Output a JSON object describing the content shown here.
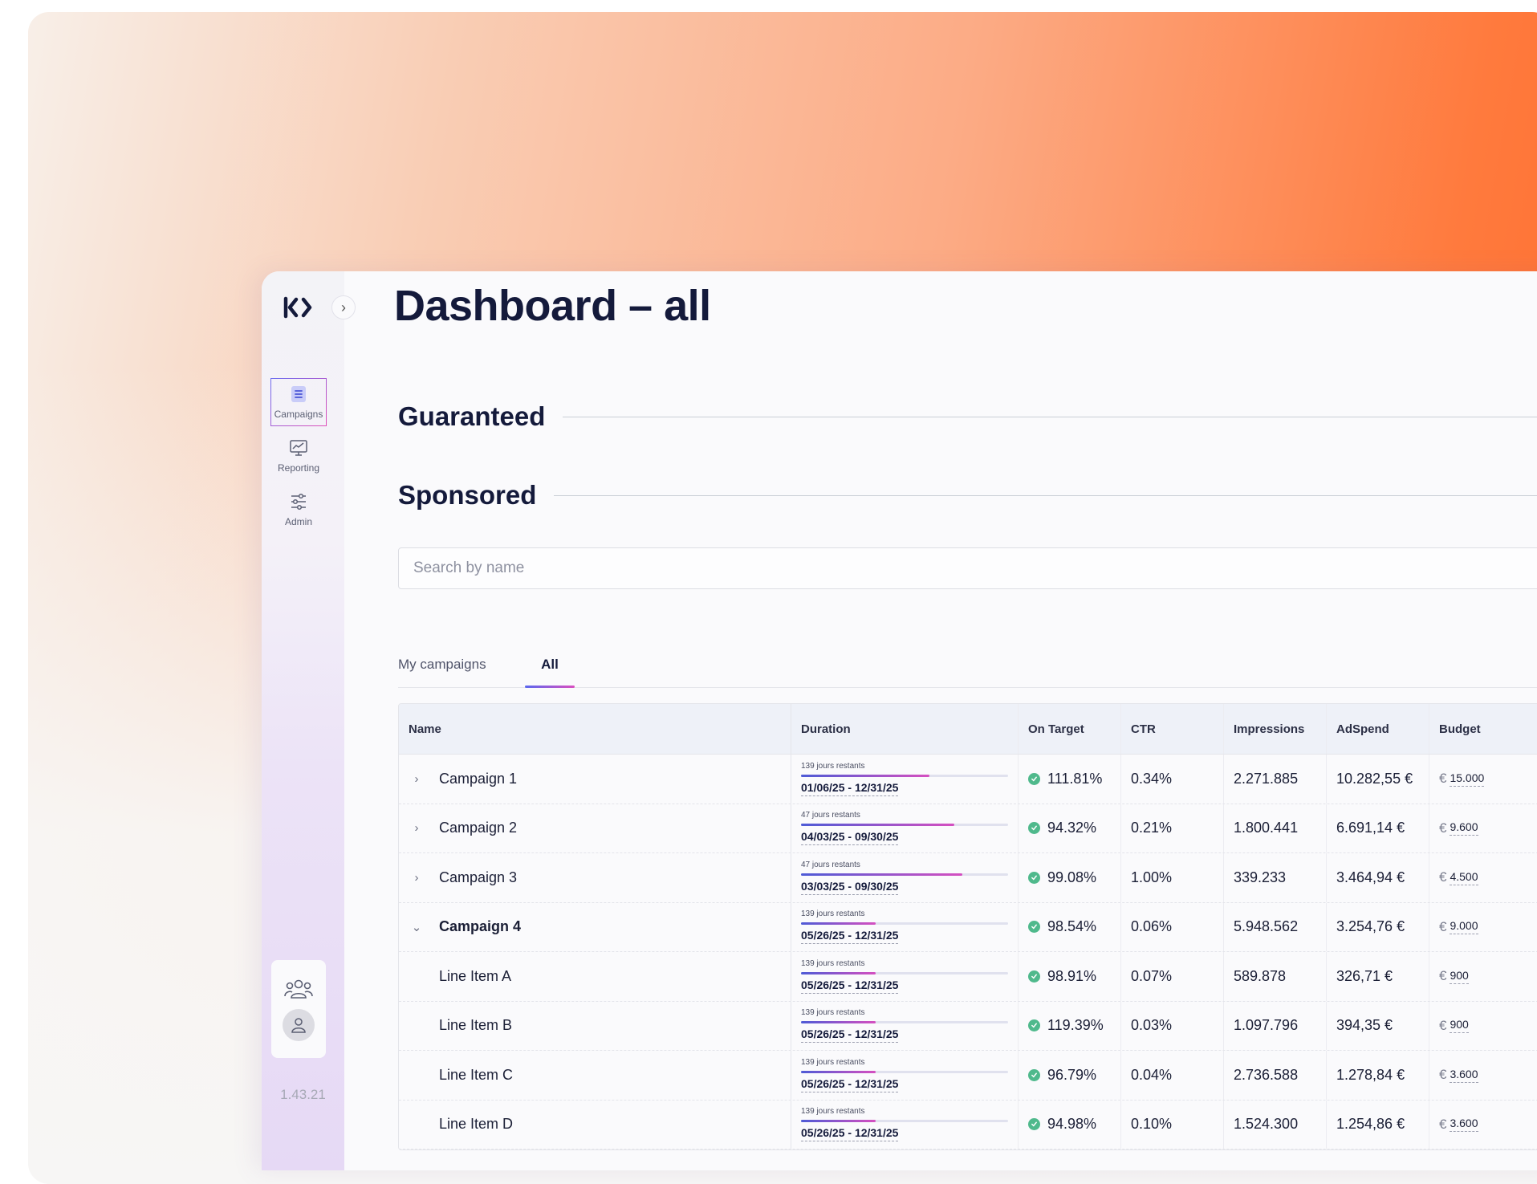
{
  "app": {
    "version": "1.43.21",
    "accent": "#ff6b2c"
  },
  "sidebar": {
    "items": [
      {
        "label": "Campaigns",
        "icon": "list-icon",
        "active": true
      },
      {
        "label": "Reporting",
        "icon": "chart-icon",
        "active": false
      },
      {
        "label": "Admin",
        "icon": "sliders-icon",
        "active": false
      }
    ]
  },
  "page": {
    "title": "Dashboard – all"
  },
  "sections": {
    "guaranteed": "Guaranteed",
    "sponsored": "Sponsored"
  },
  "search": {
    "placeholder": "Search by name",
    "value": ""
  },
  "tabs": [
    {
      "label": "My campaigns",
      "active": false
    },
    {
      "label": "All",
      "active": true
    }
  ],
  "table": {
    "headers": [
      "Name",
      "Duration",
      "On Target",
      "CTR",
      "Impressions",
      "AdSpend",
      "Budget"
    ],
    "currency_symbol": "€",
    "rows": [
      {
        "name": "Campaign 1",
        "type": "campaign",
        "expanded": false,
        "remaining": "139 jours restants",
        "progress": 0.62,
        "dates": "01/06/25 - 12/31/25",
        "on_target": "111.81%",
        "ctr": "0.34%",
        "impressions": "2.271.885",
        "adspend": "10.282,55 €",
        "budget": "15.000"
      },
      {
        "name": "Campaign 2",
        "type": "campaign",
        "expanded": false,
        "remaining": "47 jours restants",
        "progress": 0.74,
        "dates": "04/03/25 - 09/30/25",
        "on_target": "94.32%",
        "ctr": "0.21%",
        "impressions": "1.800.441",
        "adspend": "6.691,14 €",
        "budget": "9.600"
      },
      {
        "name": "Campaign 3",
        "type": "campaign",
        "expanded": false,
        "remaining": "47 jours restants",
        "progress": 0.78,
        "dates": "03/03/25 - 09/30/25",
        "on_target": "99.08%",
        "ctr": "1.00%",
        "impressions": "339.233",
        "adspend": "3.464,94 €",
        "budget": "4.500"
      },
      {
        "name": "Campaign 4",
        "type": "campaign",
        "expanded": true,
        "remaining": "139 jours restants",
        "progress": 0.36,
        "dates": "05/26/25 - 12/31/25",
        "on_target": "98.54%",
        "ctr": "0.06%",
        "impressions": "5.948.562",
        "adspend": "3.254,76 €",
        "budget": "9.000"
      },
      {
        "name": "Line Item A",
        "type": "line_item",
        "expanded": false,
        "remaining": "139 jours restants",
        "progress": 0.36,
        "dates": "05/26/25 - 12/31/25",
        "on_target": "98.91%",
        "ctr": "0.07%",
        "impressions": "589.878",
        "adspend": "326,71 €",
        "budget": "900"
      },
      {
        "name": "Line Item B",
        "type": "line_item",
        "expanded": false,
        "remaining": "139 jours restants",
        "progress": 0.36,
        "dates": "05/26/25 - 12/31/25",
        "on_target": "119.39%",
        "ctr": "0.03%",
        "impressions": "1.097.796",
        "adspend": "394,35 €",
        "budget": "900"
      },
      {
        "name": "Line Item C",
        "type": "line_item",
        "expanded": false,
        "remaining": "139 jours restants",
        "progress": 0.36,
        "dates": "05/26/25 - 12/31/25",
        "on_target": "96.79%",
        "ctr": "0.04%",
        "impressions": "2.736.588",
        "adspend": "1.278,84 €",
        "budget": "3.600"
      },
      {
        "name": "Line Item D",
        "type": "line_item",
        "expanded": false,
        "remaining": "139 jours restants",
        "progress": 0.36,
        "dates": "05/26/25 - 12/31/25",
        "on_target": "94.98%",
        "ctr": "0.10%",
        "impressions": "1.524.300",
        "adspend": "1.254,86 €",
        "budget": "3.600"
      }
    ]
  }
}
